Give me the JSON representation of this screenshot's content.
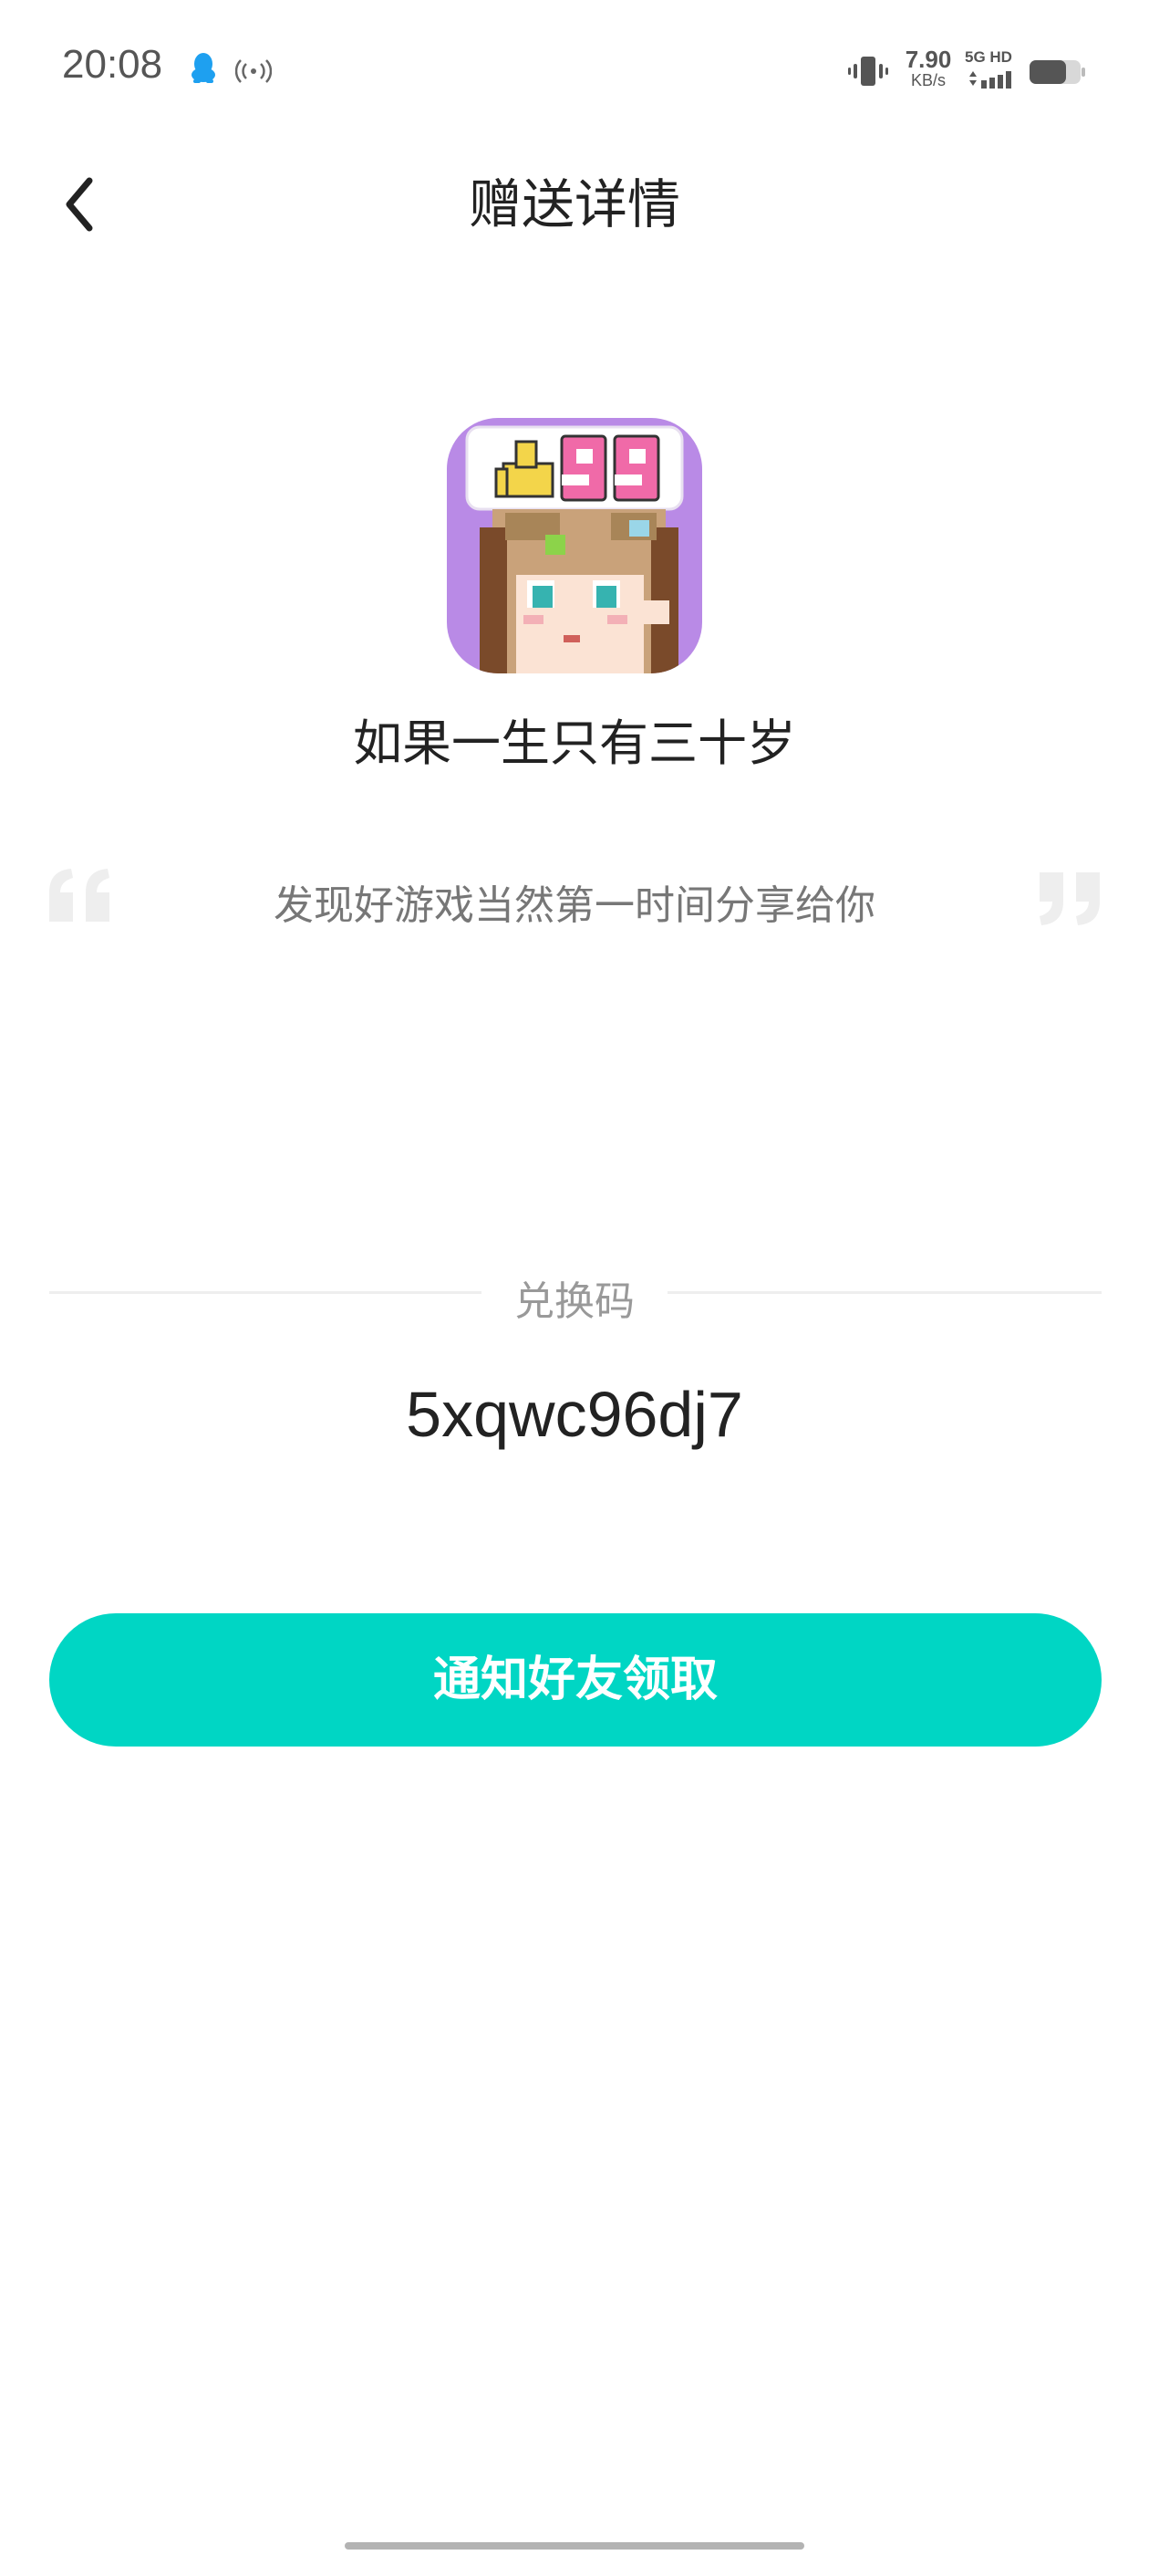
{
  "status_bar": {
    "time": "20:08",
    "speed_value": "7.90",
    "speed_unit": "KB/s",
    "network_label": "5G HD",
    "icons": [
      "qq-icon",
      "hotspot-icon",
      "vibrate-icon",
      "signal-icon",
      "battery-icon"
    ]
  },
  "header": {
    "title": "赠送详情",
    "back_icon": "chevron-left-icon"
  },
  "game": {
    "name": "如果一生只有三十岁",
    "icon": "pixel-girl-thumbs-up-99-icon",
    "icon_bg_color": "#b98ae6"
  },
  "message": {
    "text": "发现好游戏当然第一时间分享给你"
  },
  "redeem": {
    "label": "兑换码",
    "code": "5xqwc96dj7"
  },
  "button": {
    "label": "通知好友领取",
    "color": "#00d6c4"
  }
}
